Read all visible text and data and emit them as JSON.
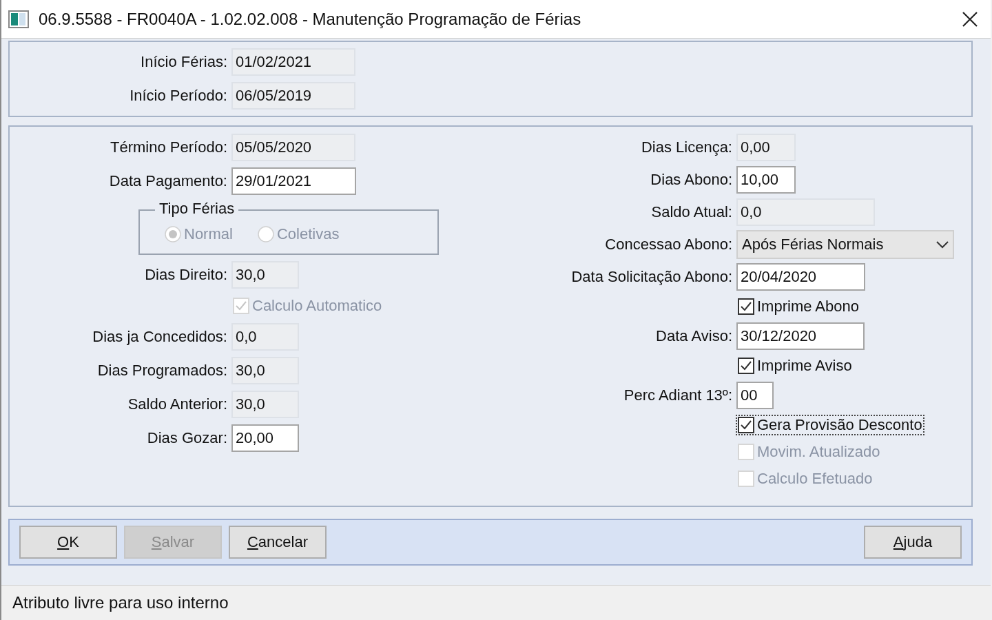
{
  "window": {
    "title": "06.9.5588 - FR0040A - 1.02.02.008 - Manutenção Programação de Férias"
  },
  "header_panel": [
    {
      "kind": "field",
      "label": "Início Férias:",
      "value": "01/02/2021",
      "editable": false
    },
    {
      "kind": "field",
      "label": "Início Período:",
      "value": "06/05/2019",
      "editable": false
    }
  ],
  "left_column": [
    {
      "kind": "field",
      "label": "Término Período:",
      "value": "05/05/2020",
      "editable": false
    },
    {
      "kind": "field",
      "label": "Data Pagamento:",
      "value": "29/01/2021",
      "editable": true
    },
    {
      "kind": "group",
      "label": "Tipo Férias",
      "options": [
        {
          "label": "Normal",
          "selected": true,
          "disabled": true
        },
        {
          "label": "Coletivas",
          "selected": false,
          "disabled": true
        }
      ]
    },
    {
      "kind": "field",
      "label": "Dias Direito:",
      "value": "30,0",
      "editable": false
    },
    {
      "kind": "checkbox",
      "label": "Calculo Automatico",
      "checked": true,
      "disabled": true,
      "focused": false
    },
    {
      "kind": "field",
      "label": "Dias ja Concedidos:",
      "value": "0,0",
      "editable": false
    },
    {
      "kind": "field",
      "label": "Dias Programados:",
      "value": "30,0",
      "editable": false
    },
    {
      "kind": "field",
      "label": "Saldo Anterior:",
      "value": "30,0",
      "editable": false
    },
    {
      "kind": "field",
      "label": "Dias Gozar:",
      "value": "20,00",
      "editable": true
    }
  ],
  "right_column": [
    {
      "kind": "field",
      "label": "Dias Licença:",
      "value": "0,00",
      "editable": false
    },
    {
      "kind": "field",
      "label": "Dias Abono:",
      "value": "10,00",
      "editable": true
    },
    {
      "kind": "field",
      "label": "Saldo Atual:",
      "value": "0,0",
      "editable": false
    },
    {
      "kind": "select",
      "label": "Concessao Abono:",
      "value": "Após Férias Normais"
    },
    {
      "kind": "field",
      "label": "Data Solicitação Abono:",
      "value": "20/04/2020",
      "editable": true
    },
    {
      "kind": "checkbox",
      "label": "Imprime Abono",
      "checked": true,
      "disabled": false,
      "focused": false
    },
    {
      "kind": "field",
      "label": "Data Aviso:",
      "value": "30/12/2020",
      "editable": true
    },
    {
      "kind": "checkbox",
      "label": "Imprime Aviso",
      "checked": true,
      "disabled": false,
      "focused": false
    },
    {
      "kind": "field",
      "label": "Perc Adiant 13º:",
      "value": "00",
      "editable": true
    },
    {
      "kind": "checkbox",
      "label": "Gera Provisão Desconto",
      "checked": true,
      "disabled": false,
      "focused": true
    },
    {
      "kind": "checkbox",
      "label": "Movim. Atualizado",
      "checked": false,
      "disabled": true,
      "focused": false
    },
    {
      "kind": "checkbox",
      "label": "Calculo Efetuado",
      "checked": false,
      "disabled": true,
      "focused": false
    }
  ],
  "buttons": [
    {
      "key": "O",
      "rest": "K",
      "disabled": false
    },
    {
      "key": "S",
      "rest": "alvar",
      "disabled": true
    },
    {
      "key": "C",
      "rest": "ancelar",
      "disabled": false
    },
    {
      "key": "A",
      "rest": "juda",
      "disabled": false
    }
  ],
  "status_bar": {
    "text": "Atributo livre para uso interno"
  }
}
